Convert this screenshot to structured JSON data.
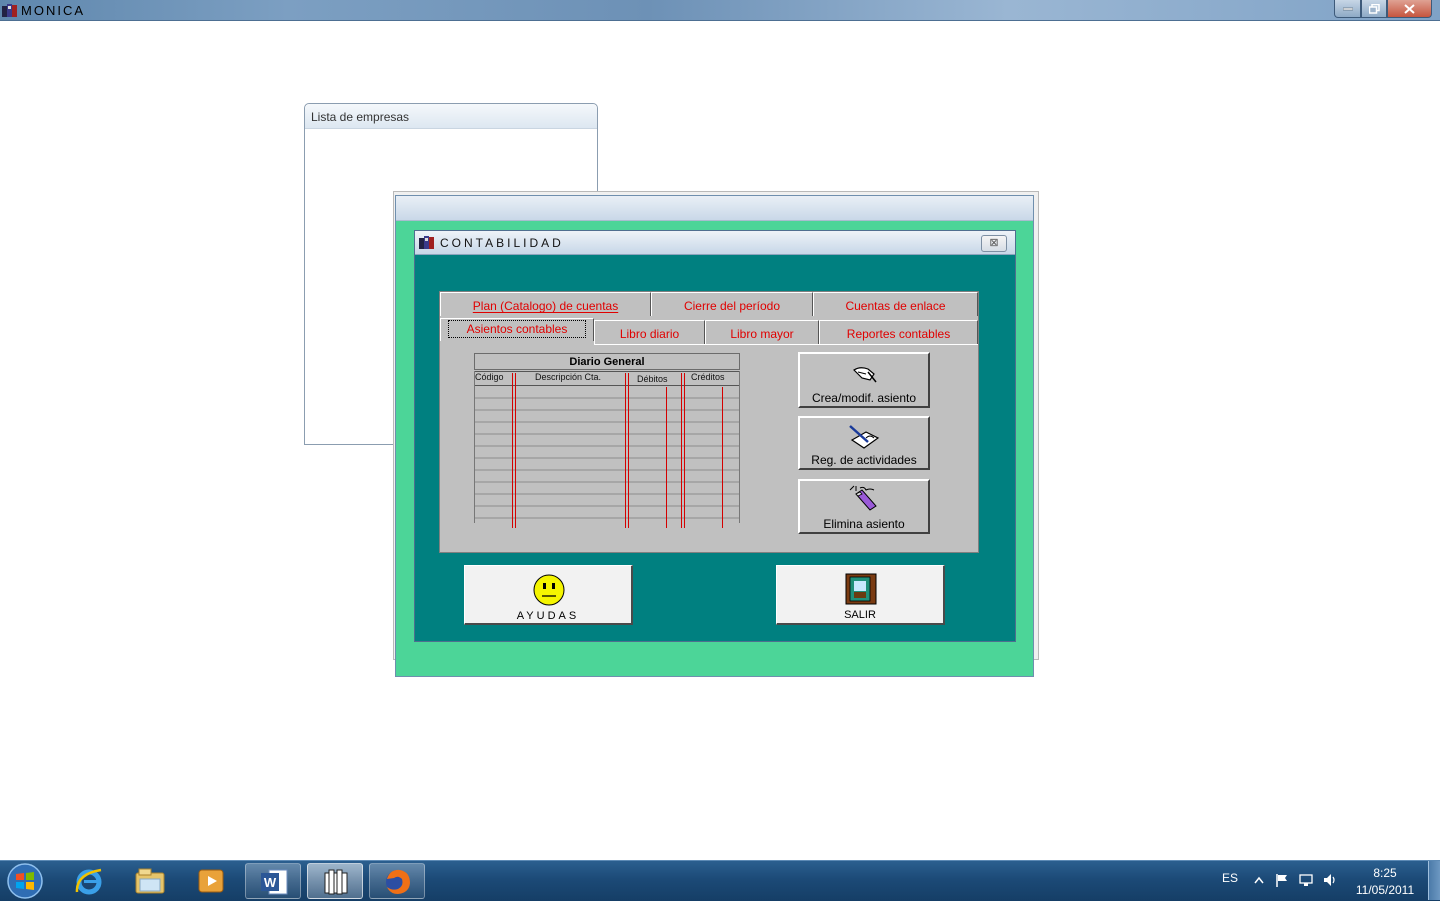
{
  "app": {
    "title": "MONICA"
  },
  "lista": {
    "title": "Lista de empresas"
  },
  "dialog": {
    "title": "CONTABILIDAD",
    "close_glyph": "⊠"
  },
  "tabs": {
    "row1": [
      {
        "label": "Plan (Catalogo) de cuentas"
      },
      {
        "label": "Cierre del período"
      },
      {
        "label": "Cuentas de enlace"
      }
    ],
    "row2": [
      {
        "label": "Asientos contables",
        "active": true
      },
      {
        "label": "Libro diario"
      },
      {
        "label": "Libro mayor"
      },
      {
        "label": "Reportes contables"
      }
    ]
  },
  "ledger": {
    "title": "Diario General",
    "columns": [
      "Código",
      "Descripción Cta.",
      "Débitos",
      "Créditos"
    ]
  },
  "actions": {
    "create": "Crea/modif. asiento",
    "register": "Reg. de actividades",
    "delete": "Elimina asiento"
  },
  "bottom": {
    "help": "AYUDAS",
    "exit": "SALIR"
  },
  "taskbar": {
    "language": "ES",
    "time": "8:25",
    "date": "11/05/2011",
    "items": [
      "internet-explorer-icon",
      "windows-explorer-icon",
      "media-player-icon",
      "word-icon",
      "monica-app-icon",
      "firefox-icon"
    ]
  },
  "colors": {
    "dialog_bg": "#008080",
    "outer_bg": "#4cd598",
    "tab_text": "#e00000",
    "panel_gray": "#c0c0c0"
  }
}
